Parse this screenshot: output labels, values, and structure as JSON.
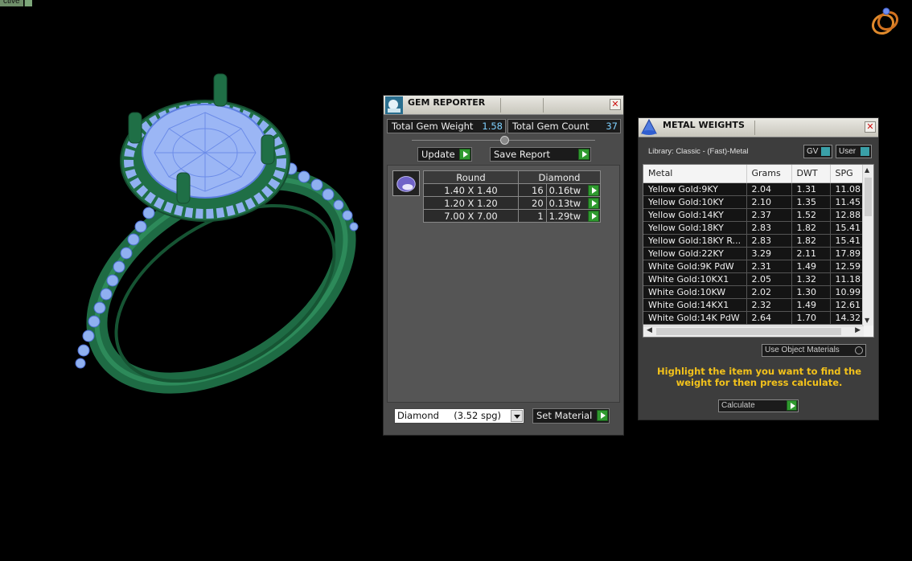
{
  "viewport": {
    "tag": "ctive"
  },
  "gem_reporter": {
    "title": "GEM REPORTER",
    "total_gem_weight_label": "Total Gem Weight",
    "total_gem_weight": "1.58",
    "total_gem_count_label": "Total Gem Count",
    "total_gem_count": "37",
    "update_label": "Update",
    "save_report_label": "Save Report",
    "header": [
      "Round",
      "Diamond"
    ],
    "rows": [
      {
        "size": "1.40 X 1.40",
        "count": "16",
        "weight": "0.16tw"
      },
      {
        "size": "1.20 X 1.20",
        "count": "20",
        "weight": "0.13tw"
      },
      {
        "size": "7.00 X 7.00",
        "count": "1",
        "weight": "1.29tw"
      }
    ],
    "material_selected": "Diamond     (3.52 spg)",
    "set_material_label": "Set Material"
  },
  "metal_weights": {
    "title": "METAL WEIGHTS",
    "library_label": "Library: Classic - (Fast)-Metal",
    "toggle_gv": "GV",
    "toggle_user": "User",
    "columns": [
      "Metal",
      "Grams",
      "DWT",
      "SPG"
    ],
    "rows": [
      [
        "Yellow Gold:9KY",
        "2.04",
        "1.31",
        "11.08"
      ],
      [
        "Yellow Gold:10KY",
        "2.10",
        "1.35",
        "11.45"
      ],
      [
        "Yellow Gold:14KY",
        "2.37",
        "1.52",
        "12.88"
      ],
      [
        "Yellow Gold:18KY",
        "2.83",
        "1.82",
        "15.41"
      ],
      [
        "Yellow Gold:18KY R...",
        "2.83",
        "1.82",
        "15.41"
      ],
      [
        "Yellow Gold:22KY",
        "3.29",
        "2.11",
        "17.89"
      ],
      [
        "White Gold:9K PdW",
        "2.31",
        "1.49",
        "12.59"
      ],
      [
        "White Gold:10KX1",
        "2.05",
        "1.32",
        "11.18"
      ],
      [
        "White Gold:10KW",
        "2.02",
        "1.30",
        "10.99"
      ],
      [
        "White Gold:14KX1",
        "2.32",
        "1.49",
        "12.61"
      ],
      [
        "White Gold:14K PdW",
        "2.64",
        "1.70",
        "14.32"
      ]
    ],
    "use_object_materials_label": "Use Object Materials",
    "hint": "Highlight the item you want to find the weight for then press calculate.",
    "calculate_label": "Calculate"
  }
}
